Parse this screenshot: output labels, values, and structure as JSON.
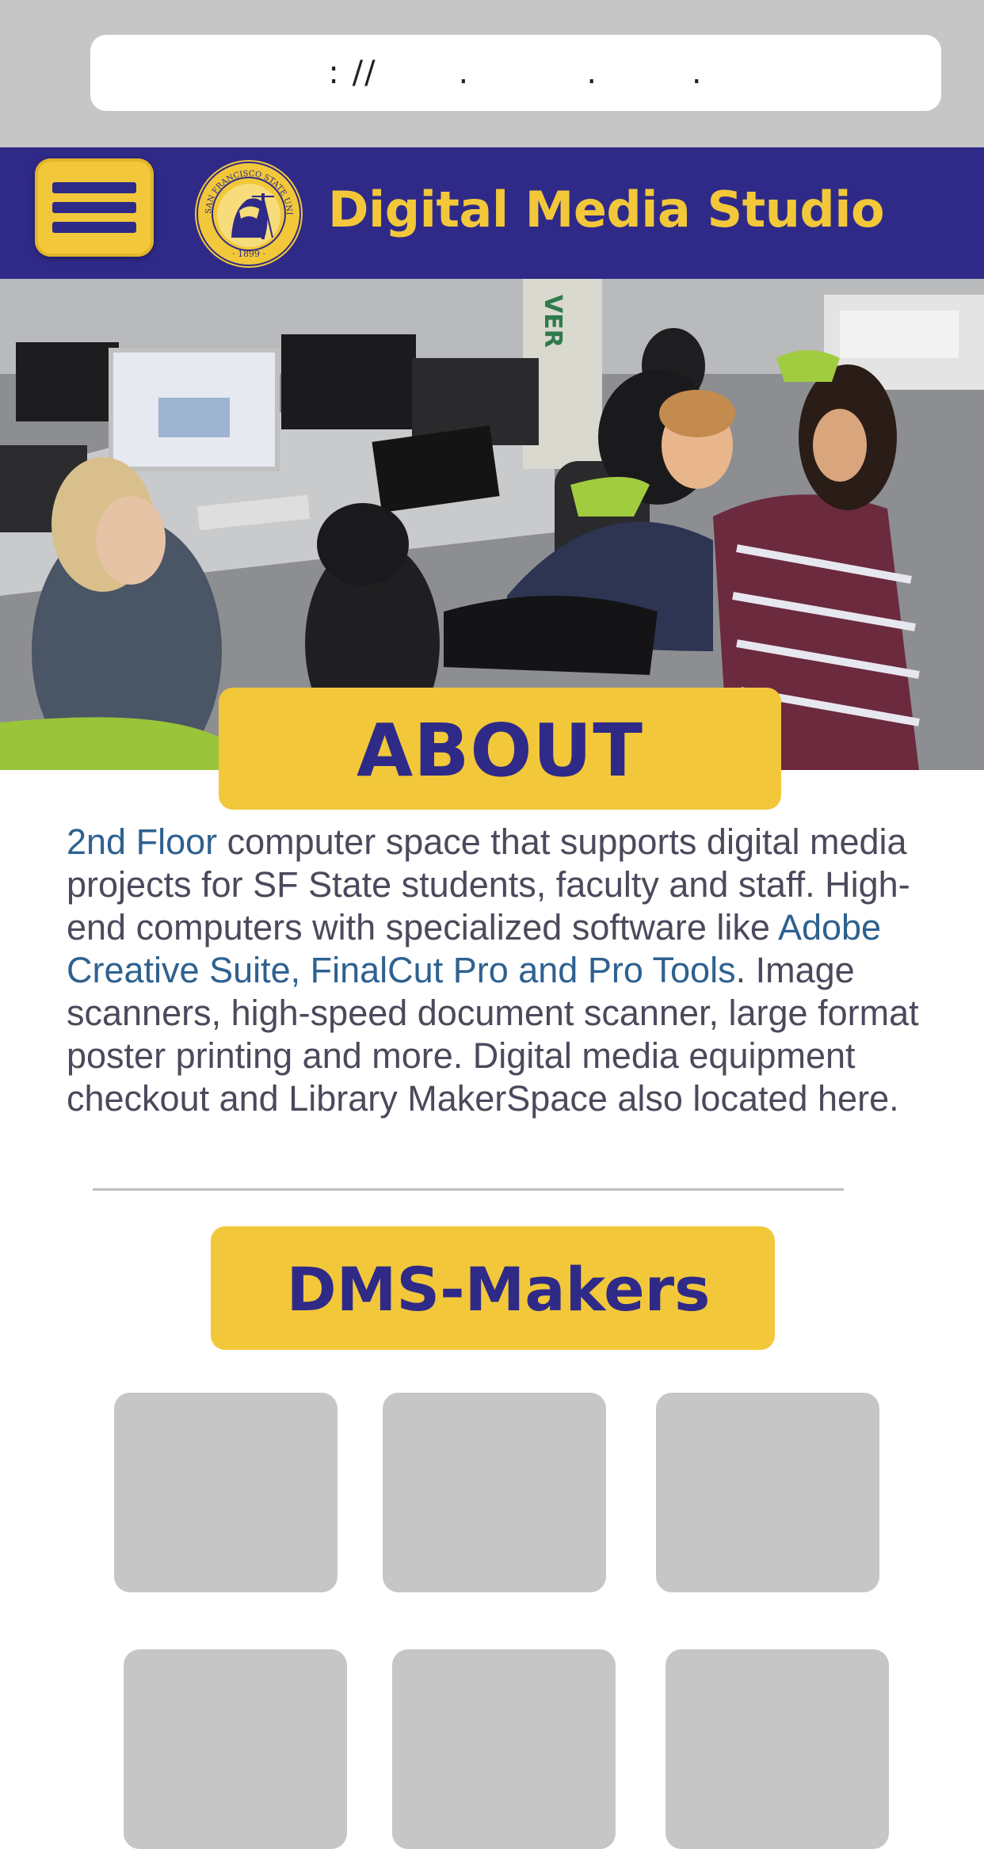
{
  "browser": {
    "url_text": ": //       .          .        ."
  },
  "header": {
    "title": "Digital Media Studio",
    "seal_text": "SAN FRANCISCO STATE UNIVERSITY • 1899"
  },
  "about": {
    "heading": "ABOUT",
    "floor_link": "2nd Floor",
    "text_1": " computer space that supports digital media projects for SF State students, faculty and staff. High-end computers with specialized software like ",
    "software_link": "Adobe Creative Suite, FinalCut Pro and Pro Tools",
    "text_2": ". Image scanners, high-speed document scanner, large format poster printing and more. Digital media equipment checkout and Library MakerSpace also located here."
  },
  "makers": {
    "heading": "DMS-Makers"
  },
  "colors": {
    "navy": "#2f2a88",
    "gold": "#f2c83a",
    "gray": "#c6c6c6",
    "link": "#2e6190",
    "text": "#4b4a5c"
  }
}
